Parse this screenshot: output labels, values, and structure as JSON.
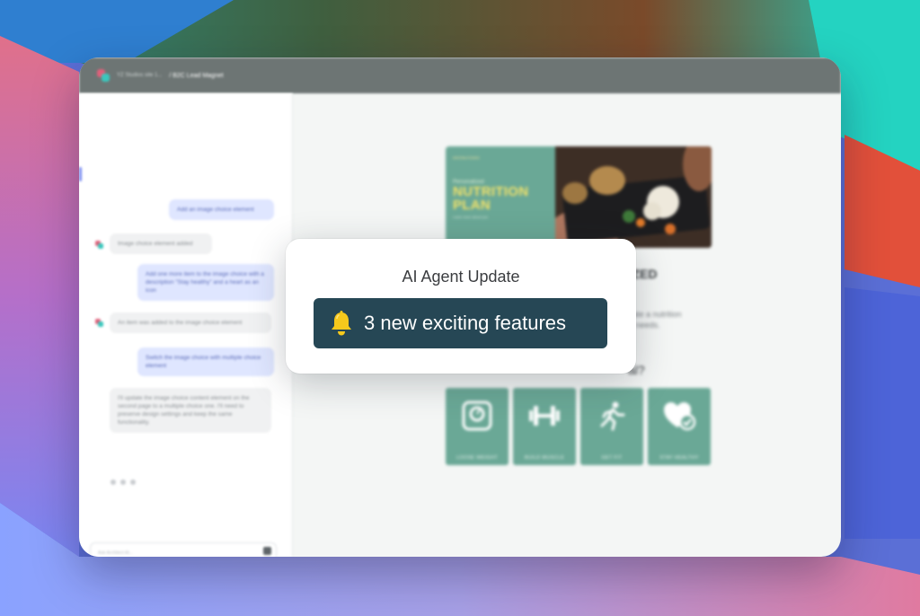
{
  "colors": {
    "titlebar": "#6d7574",
    "popup_badge": "#264755",
    "choice_tile": "#6aa896",
    "hero_title": "#f2e26a",
    "bell": "#f6c91c",
    "user_bubble": "#dfe6ff"
  },
  "window": {
    "breadcrumb_parent": "YZ Studios site 1...",
    "breadcrumb_current": "/ B2C Lead Magnet"
  },
  "chat": {
    "messages": [
      {
        "role": "user",
        "text": "Add an image choice element"
      },
      {
        "role": "bot",
        "text": "Image choice element added"
      },
      {
        "role": "user",
        "text": "Add one more item to the image choice with a description \"Stay healthy\" and a heart as an icon"
      },
      {
        "role": "bot",
        "text": "An item was added to the image choice element"
      },
      {
        "role": "user",
        "text": "Switch the image choice with multiple choice element"
      },
      {
        "role": "bot",
        "text": "I'll update the image choice content element on the second page to a multiple choice one. I'll need to preserve design settings and keep the same functionality."
      }
    ],
    "input_placeholder": "Ask Architect AI...",
    "send_icon": "send-icon"
  },
  "preview": {
    "hero": {
      "tag": "DIGITALFOODS",
      "kicker": "Personalized",
      "title": "NUTRITION PLAN",
      "subtitle": "Learn more about you"
    },
    "headline": "LIZED",
    "description_line1": "erate a nutrition",
    "description_line2": "fic needs.",
    "question": "al?",
    "choices": [
      {
        "label": "LOOSE WEIGHT",
        "icon": "scale-icon"
      },
      {
        "label": "BUILD MUSCLE",
        "icon": "dumbbell-icon"
      },
      {
        "label": "GET FIT",
        "icon": "running-icon"
      },
      {
        "label": "STAY HEALTHY",
        "icon": "heart-check-icon"
      }
    ]
  },
  "popup": {
    "title": "AI Agent Update",
    "badge_icon": "bell-icon",
    "badge_text": "3 new exciting features"
  }
}
